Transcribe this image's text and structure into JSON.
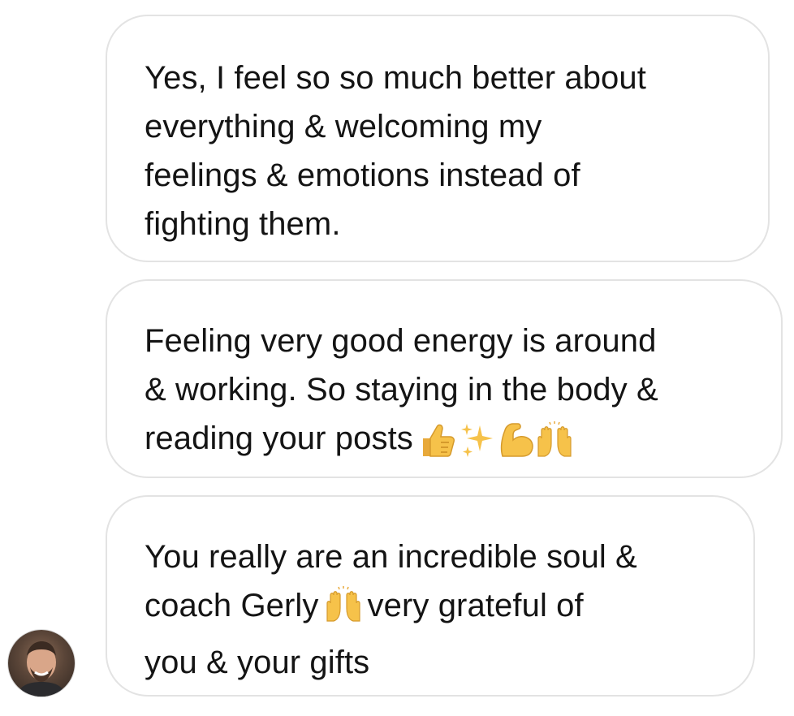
{
  "conversation": {
    "messages": [
      {
        "lines": [
          "Yes, I feel so so much better about",
          "everything & welcoming my",
          "feelings & emotions instead of",
          "fighting them."
        ]
      },
      {
        "lines": [
          "Feeling very good energy is around",
          "& working. So staying in the body &",
          "reading your posts"
        ],
        "emojis": [
          "thumbs-up-icon",
          "sparkles-icon",
          "flexed-biceps-icon",
          "raising-hands-icon"
        ]
      },
      {
        "lines": [
          "You really are an incredible soul &",
          "coach Gerly",
          "very grateful of",
          "you & your gifts"
        ],
        "inline_emoji": "raising-hands-icon"
      }
    ]
  },
  "colors": {
    "bubble_border": "#e3e3e3",
    "text": "#141414",
    "emoji_yellow": "#f6c24a"
  }
}
